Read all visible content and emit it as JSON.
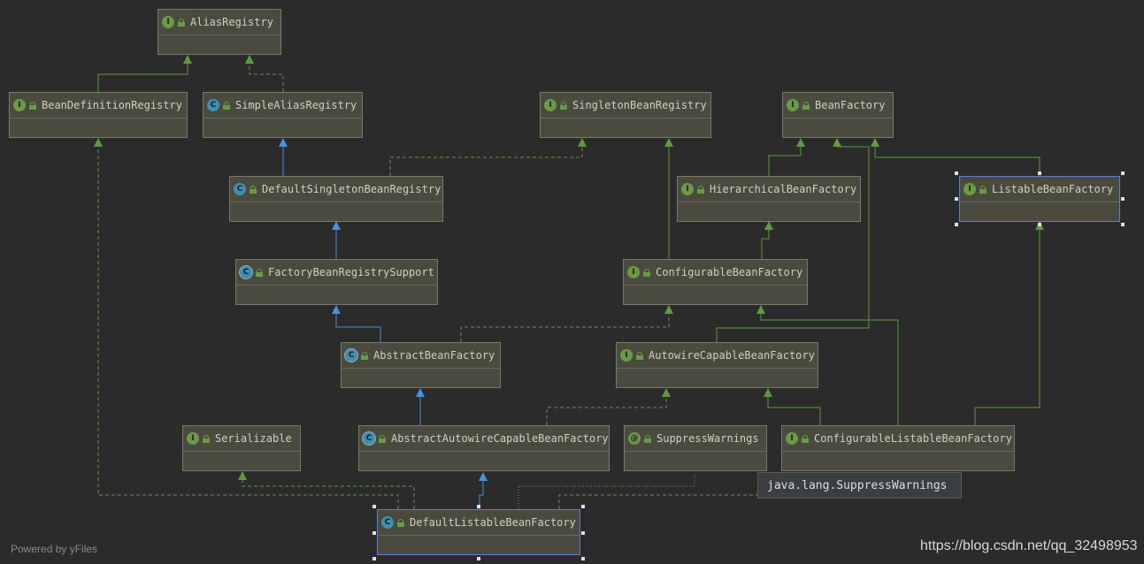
{
  "nodes": {
    "alias_registry": {
      "label": "AliasRegistry",
      "kind": "interface"
    },
    "bean_definition_registry": {
      "label": "BeanDefinitionRegistry",
      "kind": "interface"
    },
    "simple_alias_registry": {
      "label": "SimpleAliasRegistry",
      "kind": "class"
    },
    "singleton_bean_registry": {
      "label": "SingletonBeanRegistry",
      "kind": "interface"
    },
    "bean_factory": {
      "label": "BeanFactory",
      "kind": "interface"
    },
    "default_singleton_bean_registry": {
      "label": "DefaultSingletonBeanRegistry",
      "kind": "class"
    },
    "hierarchical_bean_factory": {
      "label": "HierarchicalBeanFactory",
      "kind": "interface"
    },
    "listable_bean_factory": {
      "label": "ListableBeanFactory",
      "kind": "interface"
    },
    "factory_bean_registry_support": {
      "label": "FactoryBeanRegistrySupport",
      "kind": "abstract-class"
    },
    "configurable_bean_factory": {
      "label": "ConfigurableBeanFactory",
      "kind": "interface"
    },
    "abstract_bean_factory": {
      "label": "AbstractBeanFactory",
      "kind": "abstract-class"
    },
    "autowire_capable_bean_factory": {
      "label": "AutowireCapableBeanFactory",
      "kind": "interface"
    },
    "serializable": {
      "label": "Serializable",
      "kind": "interface"
    },
    "abstract_autowire_capable_bean_factory": {
      "label": "AbstractAutowireCapableBeanFactory",
      "kind": "abstract-class"
    },
    "suppress_warnings": {
      "label": "SuppressWarnings",
      "kind": "annotation"
    },
    "configurable_listable_bean_factory": {
      "label": "ConfigurableListableBeanFactory",
      "kind": "interface"
    },
    "default_listable_bean_factory": {
      "label": "DefaultListableBeanFactory",
      "kind": "class"
    }
  },
  "badges": {
    "interface": "I",
    "class": "C",
    "abstract_class": "C",
    "annotation": "@"
  },
  "tooltip": "java.lang.SuppressWarnings",
  "footer": "Powered by yFiles",
  "watermark": "https://blog.csdn.net/qq_32498953",
  "colors": {
    "background": "#2b2b2b",
    "node_fill": "#4a4b3e",
    "interface_edge": "#5f9a3f",
    "extends_edge": "#4a8fe0",
    "selection": "#5a7fd6"
  }
}
